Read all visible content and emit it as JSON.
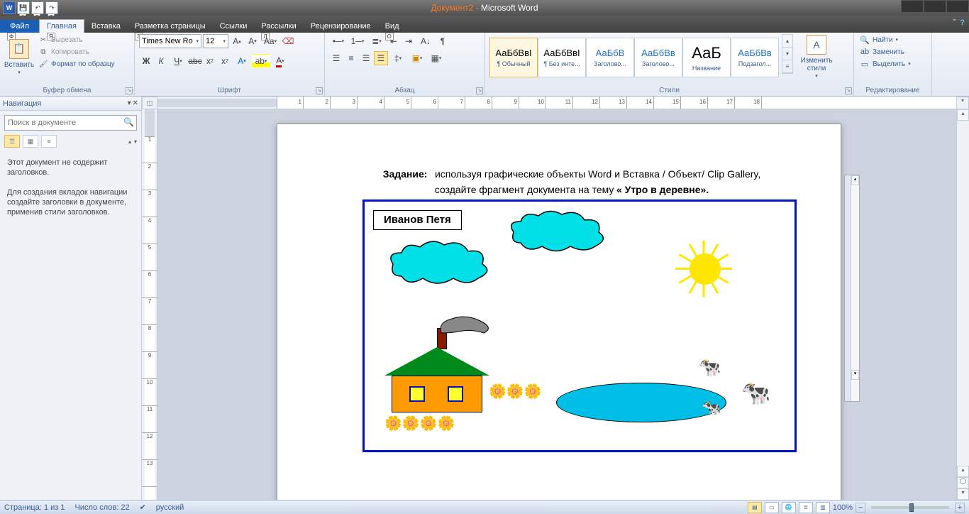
{
  "title": {
    "doc": "Документ2",
    "sep": " - ",
    "app": "Microsoft Word"
  },
  "qat_keys": [
    "1",
    "2",
    "3"
  ],
  "tabs": {
    "file": "Файл",
    "items": [
      {
        "label": "Главная",
        "key": "Я",
        "active": true
      },
      {
        "label": "Вставка",
        "key": ""
      },
      {
        "label": "Разметка страницы",
        "key": "З"
      },
      {
        "label": "Ссылки",
        "key": ""
      },
      {
        "label": "Рассылки",
        "key": "Л"
      },
      {
        "label": "Рецензирование",
        "key": ""
      },
      {
        "label": "Вид",
        "key": "О"
      }
    ],
    "file_key": "Ф"
  },
  "ribbon": {
    "clipboard": {
      "title": "Буфер обмена",
      "paste": "Вставить",
      "cut": "Вырезать",
      "copy": "Копировать",
      "format": "Формат по образцу"
    },
    "font": {
      "title": "Шрифт",
      "name": "Times New Ro",
      "size": "12"
    },
    "paragraph": {
      "title": "Абзац"
    },
    "styles": {
      "title": "Стили",
      "items": [
        {
          "sample": "АаБбВвІ",
          "label": "¶ Обычный",
          "sel": true,
          "cls": ""
        },
        {
          "sample": "АаБбВвІ",
          "label": "¶ Без инте...",
          "sel": false,
          "cls": ""
        },
        {
          "sample": "АаБбВ",
          "label": "Заголово...",
          "sel": false,
          "cls": "blue"
        },
        {
          "sample": "АаБбВв",
          "label": "Заголово...",
          "sel": false,
          "cls": "blue"
        },
        {
          "sample": "АаБ",
          "label": "Название",
          "sel": false,
          "cls": "big"
        },
        {
          "sample": "АаБбВв",
          "label": "Подзагол...",
          "sel": false,
          "cls": "blue"
        }
      ],
      "change": "Изменить стили"
    },
    "editing": {
      "title": "Редактирование",
      "find": "Найти",
      "replace": "Заменить",
      "select": "Выделить"
    }
  },
  "nav": {
    "title": "Навигация",
    "search_placeholder": "Поиск в документе",
    "text1": "Этот документ не содержит заголовков.",
    "text2": "Для создания вкладок навигации создайте заголовки в документе, применив стили заголовков."
  },
  "ruler_h": [
    "1",
    "2",
    "3",
    "4",
    "5",
    "6",
    "7",
    "8",
    "9",
    "10",
    "11",
    "12",
    "13",
    "14",
    "15",
    "16",
    "17",
    "18"
  ],
  "ruler_v": [
    "1",
    "2",
    "3",
    "4",
    "5",
    "6",
    "7",
    "8",
    "9",
    "10",
    "11",
    "12",
    "13"
  ],
  "document": {
    "task_label": "Задание:",
    "task_body": "используя графические объекты Word и Вставка / Объект/ Clip Gallery, создайте фрагмент документа на тему",
    "task_bold": "« Утро в деревне».",
    "author": "Иванов Петя"
  },
  "status": {
    "page": "Страница: 1 из 1",
    "words": "Число слов: 22",
    "lang": "русский",
    "zoom": "100%"
  }
}
